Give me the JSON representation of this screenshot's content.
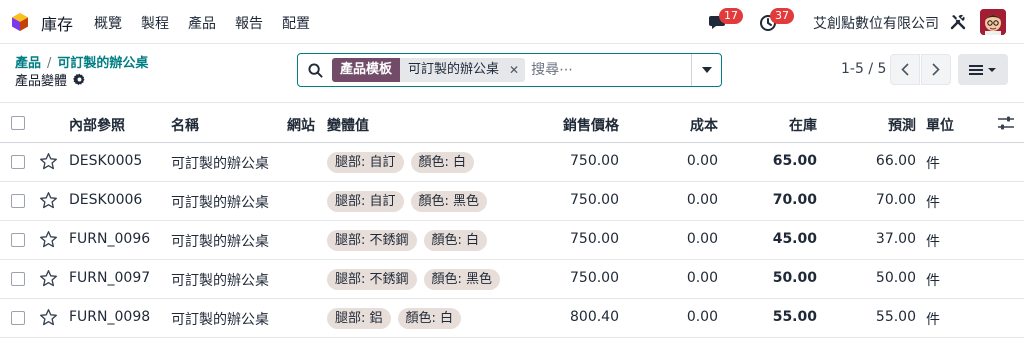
{
  "navbar": {
    "app_name": "庫存",
    "menu": [
      "概覽",
      "製程",
      "產品",
      "報告",
      "配置"
    ],
    "messages_count": "17",
    "activities_count": "37",
    "company": "艾創點數位有限公司"
  },
  "control_panel": {
    "breadcrumb_parent": "產品",
    "breadcrumb_current": "可訂製的辦公桌",
    "page_title": "產品變體",
    "search": {
      "facet_label": "產品模板",
      "facet_value": "可訂製的辦公桌",
      "placeholder": "搜尋⋯"
    },
    "pager": "1-5 / 5"
  },
  "table": {
    "headers": {
      "ref": "內部參照",
      "name": "名稱",
      "website": "網站",
      "variants": "變體值",
      "price": "銷售價格",
      "cost": "成本",
      "on_hand": "在庫",
      "forecast": "預測",
      "uom": "單位"
    },
    "rows": [
      {
        "ref": "DESK0005",
        "name": "可訂製的辦公桌",
        "tags": [
          "腿部: 自訂",
          "顏色: 白"
        ],
        "price": "750.00",
        "cost": "0.00",
        "on_hand": "65.00",
        "forecast": "66.00",
        "uom": "件"
      },
      {
        "ref": "DESK0006",
        "name": "可訂製的辦公桌",
        "tags": [
          "腿部: 自訂",
          "顏色: 黑色"
        ],
        "price": "750.00",
        "cost": "0.00",
        "on_hand": "70.00",
        "forecast": "70.00",
        "uom": "件"
      },
      {
        "ref": "FURN_0096",
        "name": "可訂製的辦公桌",
        "tags": [
          "腿部: 不銹鋼",
          "顏色: 白"
        ],
        "price": "750.00",
        "cost": "0.00",
        "on_hand": "45.00",
        "forecast": "37.00",
        "uom": "件"
      },
      {
        "ref": "FURN_0097",
        "name": "可訂製的辦公桌",
        "tags": [
          "腿部: 不銹鋼",
          "顏色: 黑色"
        ],
        "price": "750.00",
        "cost": "0.00",
        "on_hand": "50.00",
        "forecast": "50.00",
        "uom": "件"
      },
      {
        "ref": "FURN_0098",
        "name": "可訂製的辦公桌",
        "tags": [
          "腿部: 鋁",
          "顏色: 白"
        ],
        "price": "800.40",
        "cost": "0.00",
        "on_hand": "55.00",
        "forecast": "55.00",
        "uom": "件"
      }
    ]
  },
  "colors": {
    "brand": "#714b67",
    "accent": "#017e84",
    "badge": "#e23b3b",
    "tag_bg": "#e7ddd9"
  },
  "icons": [
    "inventory-logo-icon",
    "chat-icon",
    "clock-icon",
    "tools-icon",
    "gear-icon",
    "search-icon",
    "chevron-down-icon",
    "chevron-left-icon",
    "chevron-right-icon",
    "list-view-icon",
    "star-icon",
    "sliders-icon"
  ]
}
